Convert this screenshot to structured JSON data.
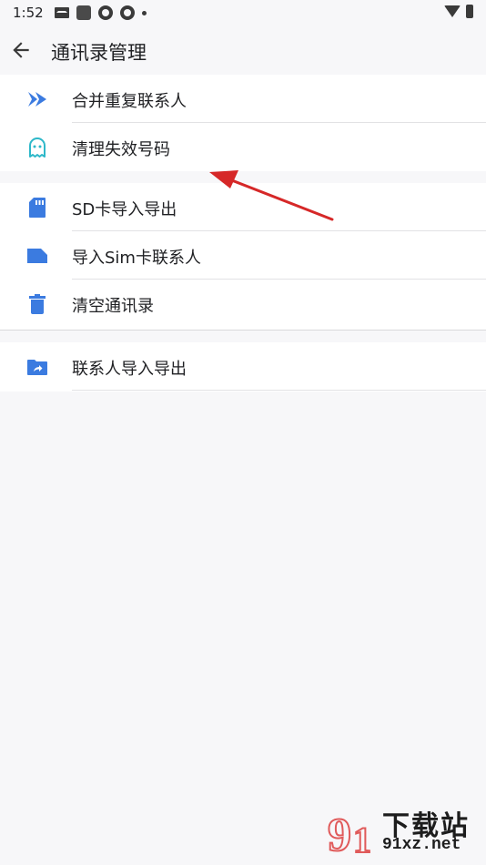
{
  "status_bar": {
    "time": "1:52"
  },
  "header": {
    "title": "通讯录管理"
  },
  "menu": {
    "group1": [
      {
        "label": "合并重复联系人",
        "icon": "merge-arrows-icon"
      },
      {
        "label": "清理失效号码",
        "icon": "ghost-icon"
      }
    ],
    "group2": [
      {
        "label": "SD卡导入导出",
        "icon": "sd-card-icon"
      },
      {
        "label": "导入Sim卡联系人",
        "icon": "sim-card-icon"
      },
      {
        "label": "清空通讯录",
        "icon": "trash-icon"
      }
    ],
    "group3": [
      {
        "label": "联系人导入导出",
        "icon": "folder-share-icon"
      }
    ]
  },
  "watermark": {
    "name": "下载站",
    "url": "91xz.net"
  },
  "colors": {
    "accent": "#3b7be0",
    "ghost": "#2eb8c9",
    "annotation": "#d62828",
    "background": "#f7f7f9"
  }
}
